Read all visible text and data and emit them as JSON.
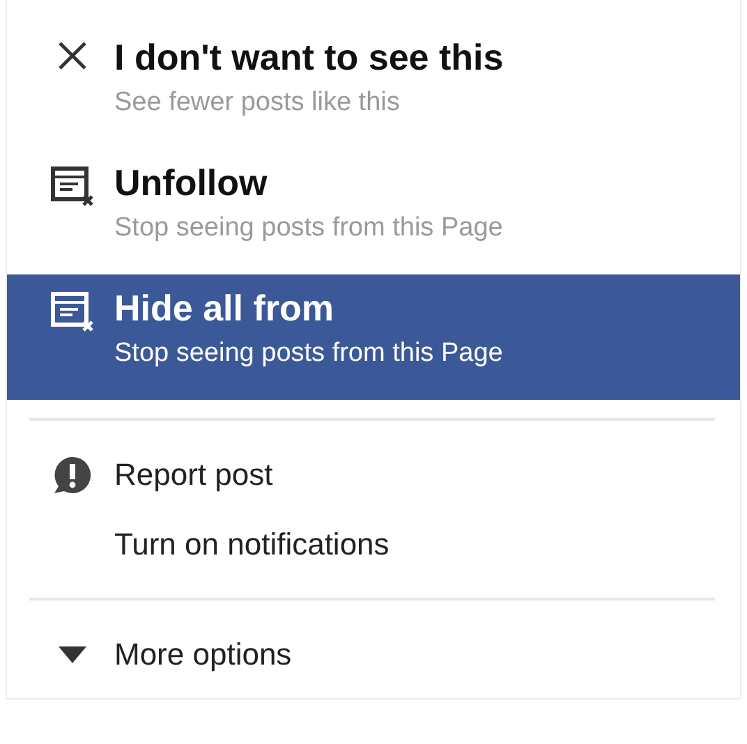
{
  "menu": {
    "sections": [
      {
        "items": [
          {
            "kind": "detailed",
            "title": "I don't want to see this",
            "subtitle": "See fewer posts like this",
            "selected": false
          },
          {
            "kind": "detailed",
            "title": "Unfollow",
            "subtitle": "Stop seeing posts from this Page",
            "selected": false
          },
          {
            "kind": "detailed",
            "title": "Hide all from",
            "subtitle": "Stop seeing posts from this Page",
            "selected": true
          }
        ]
      },
      {
        "items": [
          {
            "kind": "simple",
            "title": "Report post",
            "selected": false
          },
          {
            "kind": "simple",
            "title": "Turn on notifications",
            "selected": false
          }
        ]
      },
      {
        "items": [
          {
            "kind": "simple",
            "title": "More options",
            "selected": false
          }
        ]
      }
    ]
  }
}
